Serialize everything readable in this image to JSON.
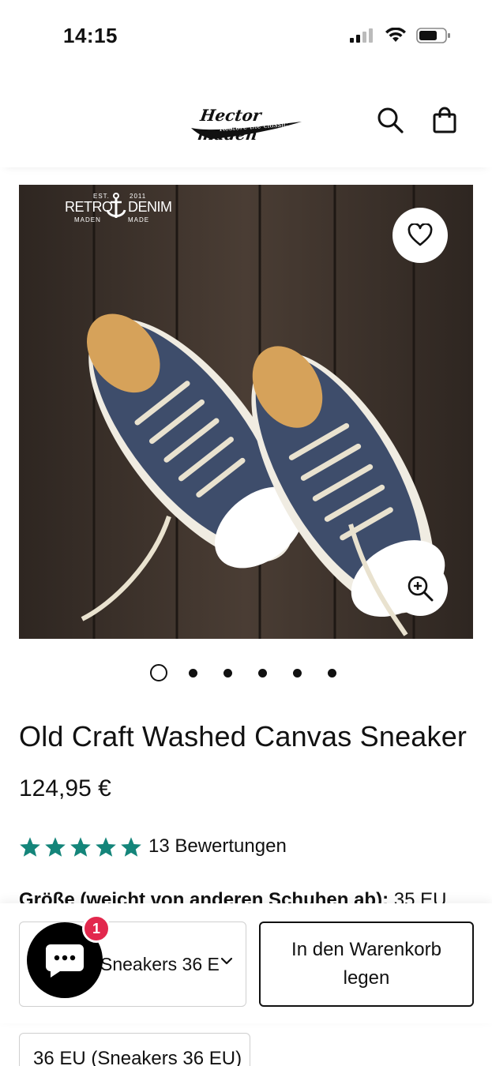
{
  "status": {
    "time": "14:15"
  },
  "header": {
    "logo_text": "Hector maden",
    "logo_tagline": "Restore the classic",
    "icons": [
      "search-icon",
      "shopping-bag-icon"
    ]
  },
  "product_image": {
    "stamp_left": "RETRO",
    "stamp_right": "DENIM",
    "stamp_est": "EST.",
    "stamp_year": "2011",
    "stamp_maden": "MADEN",
    "stamp_made": "MADE",
    "wishlist_icon": "heart-icon",
    "zoom_icon": "zoom-in-icon"
  },
  "gallery": {
    "total_slides": 6,
    "active_index": 0
  },
  "product": {
    "title": "Old Craft Washed Canvas Sneaker",
    "price": "124,95 €",
    "rating_stars": 5,
    "star_color": "#14857a",
    "reviews": "13 Bewertungen",
    "size_label_bold": "Größe (weicht von anderen Schuhen ab):",
    "size_label_value": "35 EU"
  },
  "sticky": {
    "variant_value": "Sneakers 36 E",
    "add_to_cart": "In den Warenkorb legen",
    "chat_badge": "1"
  },
  "size_option": {
    "label": "36 EU (Sneakers 36 EU)"
  }
}
